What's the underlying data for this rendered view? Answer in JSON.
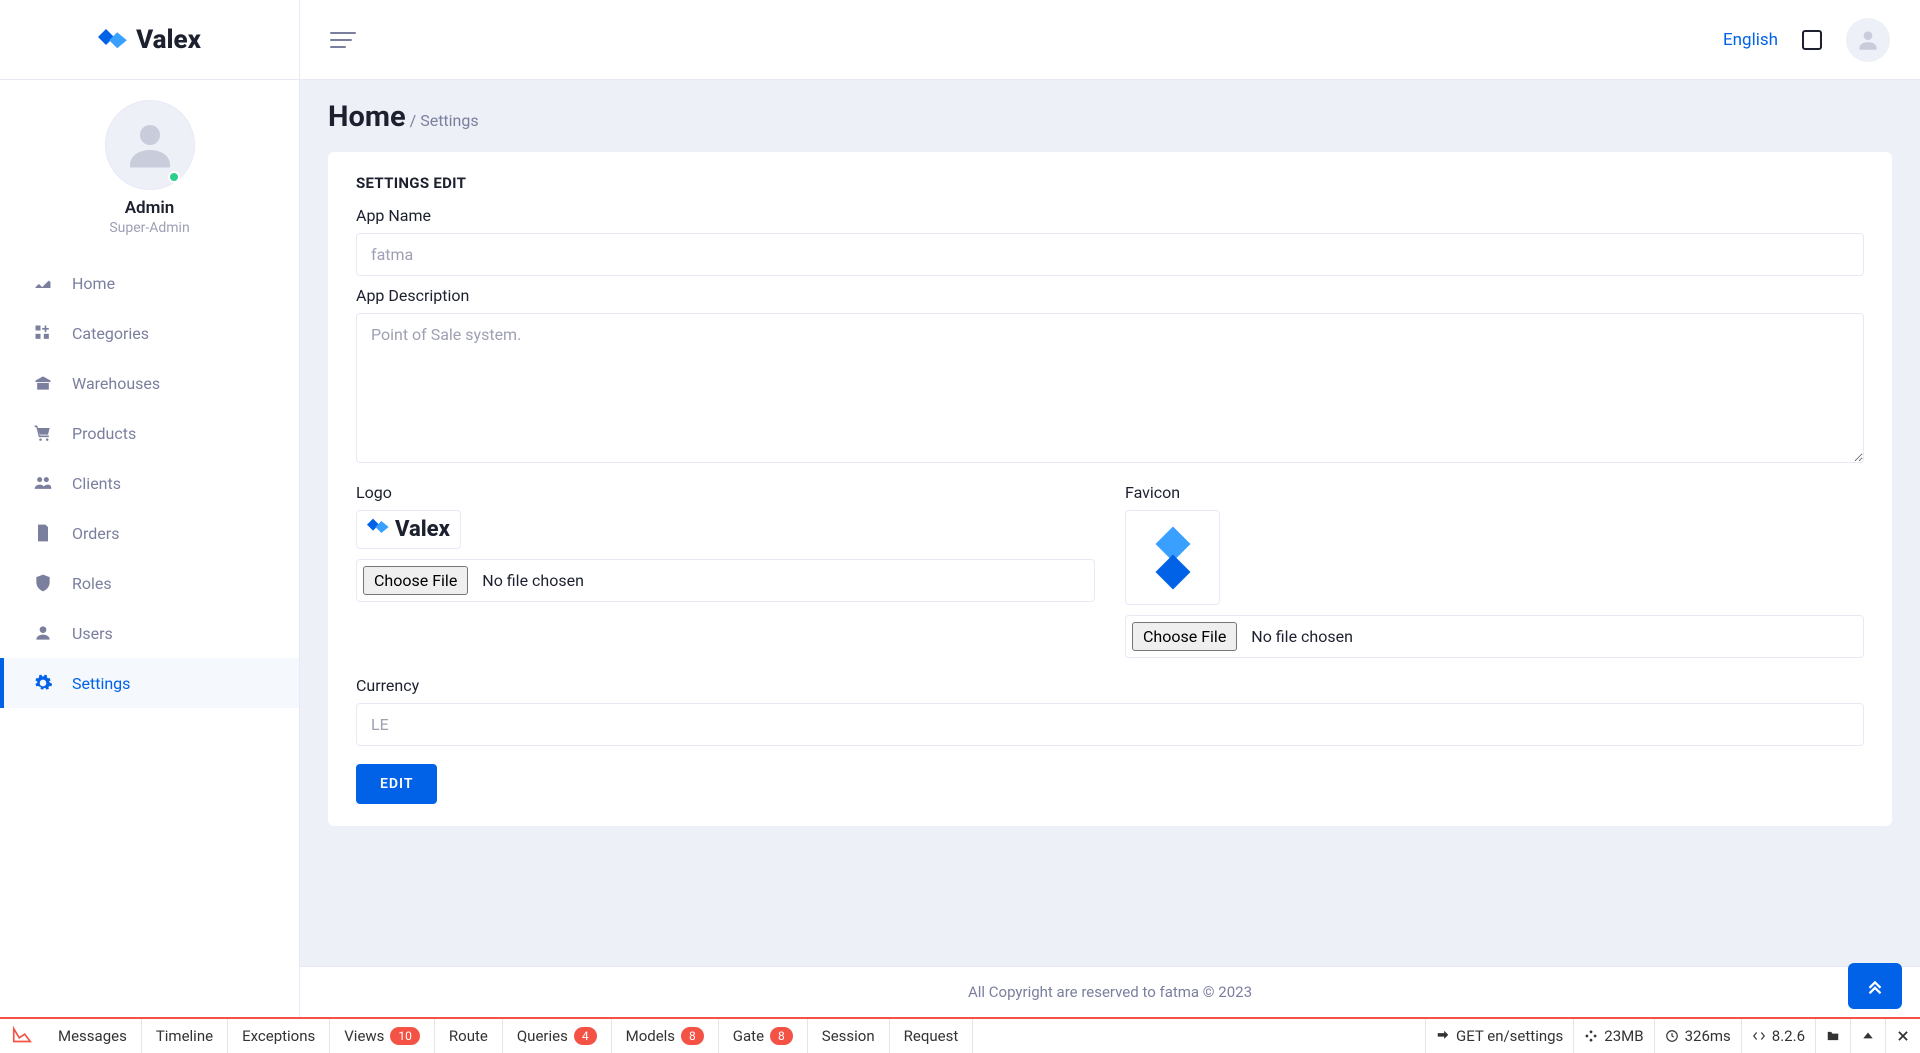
{
  "brand": {
    "name": "Valex"
  },
  "profile": {
    "name": "Admin",
    "role": "Super-Admin"
  },
  "sidebar_items": [
    {
      "label": "Home"
    },
    {
      "label": "Categories"
    },
    {
      "label": "Warehouses"
    },
    {
      "label": "Products"
    },
    {
      "label": "Clients"
    },
    {
      "label": "Orders"
    },
    {
      "label": "Roles"
    },
    {
      "label": "Users"
    },
    {
      "label": "Settings"
    }
  ],
  "header": {
    "language": "English"
  },
  "page": {
    "title": "Home",
    "crumb": "/ Settings",
    "card_title": "SETTINGS EDIT",
    "labels": {
      "app_name": "App Name",
      "app_description": "App Description",
      "logo": "Logo",
      "favicon": "Favicon",
      "currency": "Currency"
    },
    "values": {
      "app_name": "fatma",
      "app_description": "Point of Sale system.",
      "currency": "LE"
    },
    "file": {
      "choose": "Choose File",
      "none": "No file chosen"
    },
    "submit": "EDIT"
  },
  "footer": "All Copyright are reserved to fatma © 2023",
  "debug": {
    "tabs": [
      {
        "label": "Messages"
      },
      {
        "label": "Timeline"
      },
      {
        "label": "Exceptions"
      },
      {
        "label": "Views",
        "badge": "10"
      },
      {
        "label": "Route"
      },
      {
        "label": "Queries",
        "badge": "4"
      },
      {
        "label": "Models",
        "badge": "8"
      },
      {
        "label": "Gate",
        "badge": "8"
      },
      {
        "label": "Session"
      },
      {
        "label": "Request"
      }
    ],
    "right": {
      "route": "GET en/settings",
      "mem": "23MB",
      "time": "326ms",
      "php": "8.2.6"
    }
  }
}
